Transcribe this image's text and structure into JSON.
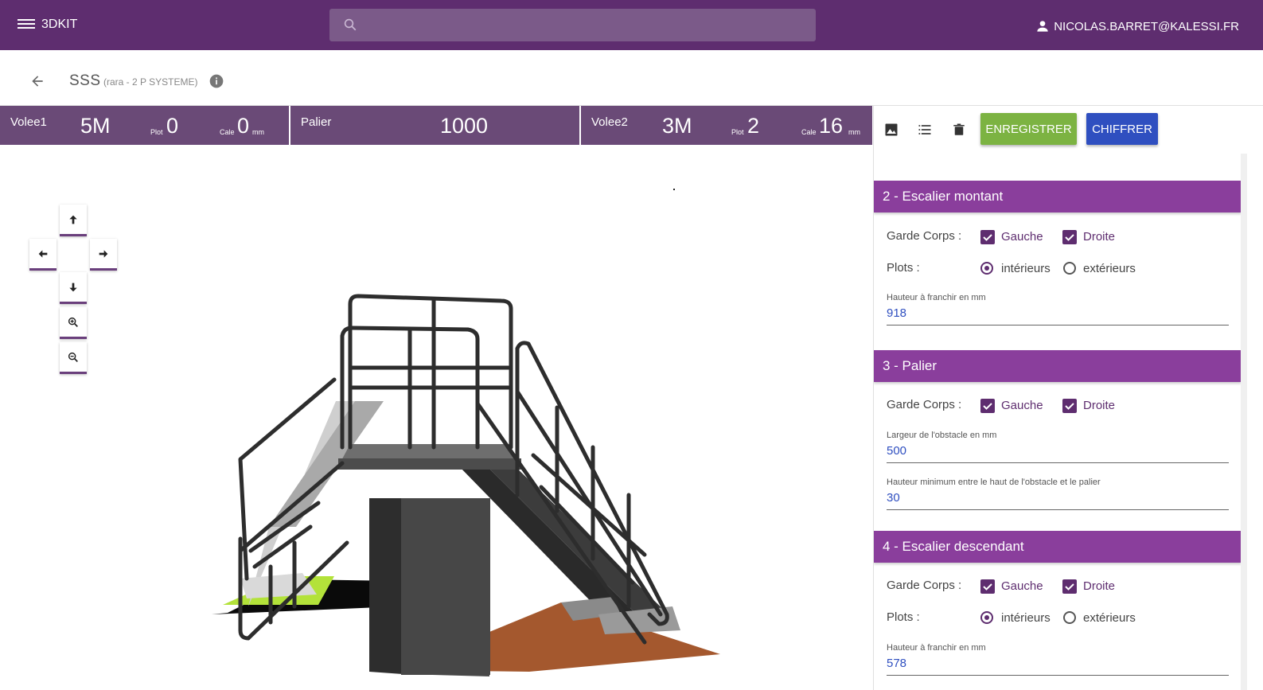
{
  "app": {
    "title": "3DKIT",
    "user": "NICOLAS.BARRET@KALESSI.FR",
    "search_placeholder": ""
  },
  "project": {
    "name": "SSS",
    "subtitle": "(rara - 2 P SYSTEME)"
  },
  "strip": {
    "volee1": {
      "label": "Volee1",
      "length": "5M",
      "plot_label": "Plot",
      "plot_value": "0",
      "cale_label": "Cale",
      "cale_value": "0",
      "unit": "mm"
    },
    "palier": {
      "label": "Palier",
      "value": "1000"
    },
    "volee2": {
      "label": "Volee2",
      "length": "3M",
      "plot_label": "Plot",
      "plot_value": "2",
      "cale_label": "Cale",
      "cale_value": "16",
      "unit": "mm"
    }
  },
  "toolbar": {
    "save_label": "ENREGISTRER",
    "quote_label": "CHIFFRER"
  },
  "sections": {
    "escalier_montant": {
      "title": "2 - Escalier montant",
      "garde_corps_label": "Garde Corps :",
      "gauche_label": "Gauche",
      "droite_label": "Droite",
      "plots_label": "Plots :",
      "interieurs_label": "intérieurs",
      "exterieurs_label": "extérieurs",
      "hauteur_label": "Hauteur à franchir en mm",
      "hauteur_value": "918"
    },
    "palier": {
      "title": "3 - Palier",
      "garde_corps_label": "Garde Corps :",
      "gauche_label": "Gauche",
      "droite_label": "Droite",
      "largeur_label": "Largeur de l'obstacle en mm",
      "largeur_value": "500",
      "hauteur_min_label": "Hauteur minimum entre le haut de l'obstacle et le palier",
      "hauteur_min_value": "30"
    },
    "escalier_descendant": {
      "title": "4 - Escalier descendant",
      "garde_corps_label": "Garde Corps :",
      "gauche_label": "Gauche",
      "droite_label": "Droite",
      "plots_label": "Plots :",
      "interieurs_label": "intérieurs",
      "exterieurs_label": "extérieurs",
      "hauteur_label": "Hauteur à franchir en mm",
      "hauteur_value": "578"
    }
  },
  "colors": {
    "primary": "#5e2d6f",
    "section": "#8a3e9c",
    "save": "#7cb342",
    "quote": "#2f4fc0",
    "strip": "#6a4a77"
  },
  "icons": [
    "menu-icon",
    "search-icon",
    "account-icon",
    "arrow-back-icon",
    "info-icon",
    "image-icon",
    "list-icon",
    "delete-icon",
    "arrow-up-icon",
    "arrow-left-icon",
    "arrow-right-icon",
    "arrow-down-icon",
    "zoom-in-icon",
    "zoom-out-icon"
  ]
}
